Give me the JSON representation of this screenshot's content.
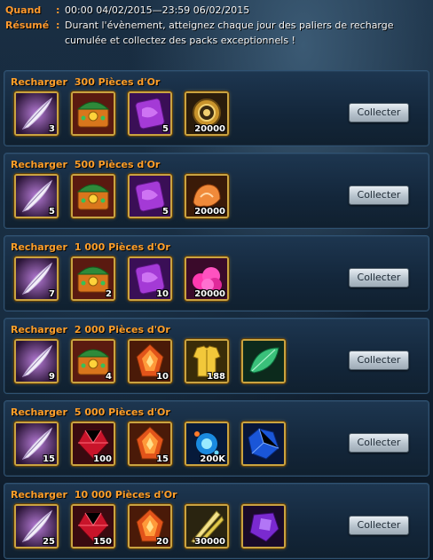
{
  "header": {
    "when_label": "Quand",
    "when_value": "00:00 04/02/2015—23:59 06/02/2015",
    "summary_label": "Résumé",
    "summary_value": "Durant l'évènement, atteignez chaque jour des paliers de recharge cumulée et collectez des packs exceptionnels !"
  },
  "tiers": [
    {
      "prefix": "Recharger",
      "amount": "300 Pièces d'Or",
      "button": "Collecter",
      "items": [
        {
          "icon": "white-feather-icon",
          "qty": "3"
        },
        {
          "icon": "jeweled-chest-icon",
          "qty": ""
        },
        {
          "icon": "purple-scroll-icon",
          "qty": "5"
        },
        {
          "icon": "gold-coin-medallion-icon",
          "qty": "20000"
        }
      ]
    },
    {
      "prefix": "Recharger",
      "amount": "500 Pièces d'Or",
      "button": "Collecter",
      "items": [
        {
          "icon": "white-feather-icon",
          "qty": "5"
        },
        {
          "icon": "jeweled-chest-icon",
          "qty": ""
        },
        {
          "icon": "purple-scroll-icon",
          "qty": "5"
        },
        {
          "icon": "orange-fire-essence-icon",
          "qty": "20000"
        }
      ]
    },
    {
      "prefix": "Recharger",
      "amount": "1 000 Pièces d'Or",
      "button": "Collecter",
      "items": [
        {
          "icon": "white-feather-icon",
          "qty": "7"
        },
        {
          "icon": "jeweled-chest-icon",
          "qty": "2"
        },
        {
          "icon": "purple-scroll-icon",
          "qty": "10"
        },
        {
          "icon": "pink-cloud-essence-icon",
          "qty": "20000"
        }
      ]
    },
    {
      "prefix": "Recharger",
      "amount": "2 000 Pièces d'Or",
      "button": "Collecter",
      "items": [
        {
          "icon": "white-feather-icon",
          "qty": "9"
        },
        {
          "icon": "jeweled-chest-icon",
          "qty": "4"
        },
        {
          "icon": "orange-flame-crystal-icon",
          "qty": "10"
        },
        {
          "icon": "golden-armor-icon",
          "qty": "188"
        },
        {
          "icon": "green-leaf-gem-icon",
          "qty": ""
        }
      ]
    },
    {
      "prefix": "Recharger",
      "amount": "5 000 Pièces d'Or",
      "button": "Collecter",
      "items": [
        {
          "icon": "white-feather-icon",
          "qty": "15"
        },
        {
          "icon": "red-ruby-icon",
          "qty": "100"
        },
        {
          "icon": "orange-flame-crystal-icon",
          "qty": "15"
        },
        {
          "icon": "blue-spirit-orb-icon",
          "qty": "200K"
        },
        {
          "icon": "blue-sapphire-icon",
          "qty": ""
        }
      ]
    },
    {
      "prefix": "Recharger",
      "amount": "10 000 Pièces d'Or",
      "button": "Collecter",
      "items": [
        {
          "icon": "white-feather-icon",
          "qty": "25"
        },
        {
          "icon": "red-ruby-icon",
          "qty": "150"
        },
        {
          "icon": "orange-flame-crystal-icon",
          "qty": "20"
        },
        {
          "icon": "golden-sword-blades-icon",
          "qty": "30000"
        },
        {
          "icon": "purple-amethyst-icon",
          "qty": ""
        }
      ]
    }
  ],
  "colors": {
    "accent_orange": "#ff9f2a",
    "panel_border": "#2f5272",
    "item_frame_gold": "#c9a341"
  }
}
